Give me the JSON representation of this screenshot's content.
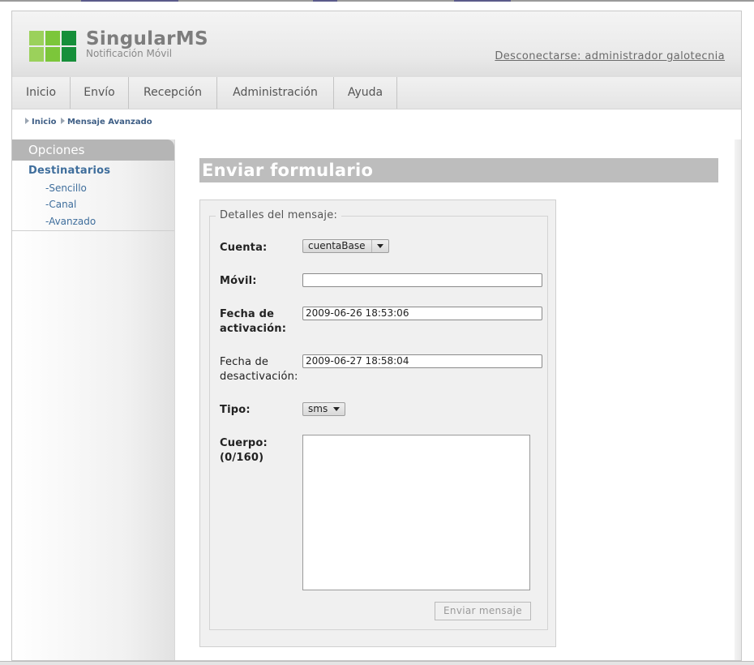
{
  "colors": {
    "logo_light_green": "#9bd15b",
    "logo_mid_green": "#7cc63a",
    "logo_dark_green": "#168f3a",
    "link_blue": "#3f6e9c",
    "title_bar_gray": "#bdbdbd"
  },
  "header": {
    "brand": "SingularMS",
    "tagline": "Notificación Móvil",
    "logout": "Desconectarse: administrador galotecnia"
  },
  "nav": {
    "items": [
      {
        "label": "Inicio"
      },
      {
        "label": "Envío"
      },
      {
        "label": "Recepción"
      },
      {
        "label": "Administración"
      },
      {
        "label": "Ayuda"
      }
    ]
  },
  "breadcrumb": [
    "Inicio",
    "Mensaje Avanzado"
  ],
  "sidebar": {
    "title": "Opciones",
    "group": "Destinatarios",
    "links": [
      "-Sencillo",
      "-Canal",
      "-Avanzado"
    ]
  },
  "form": {
    "title": "Enviar formulario",
    "legend": "Detalles del mensaje:",
    "account": {
      "label": "Cuenta:",
      "value": "cuentaBase"
    },
    "mobile": {
      "label": "Móvil:",
      "value": ""
    },
    "activation": {
      "label_line1": "Fecha de",
      "label_line2": "activación:",
      "value": "2009-06-26 18:53:06"
    },
    "deactivation": {
      "label_line1": "Fecha de",
      "label_line2": "desactivación:",
      "value": "2009-06-27 18:58:04"
    },
    "type": {
      "label": "Tipo:",
      "value": "sms"
    },
    "body": {
      "label_line1": "Cuerpo:",
      "label_line2": "(0/160)",
      "value": ""
    },
    "submit": "Enviar mensaje"
  }
}
